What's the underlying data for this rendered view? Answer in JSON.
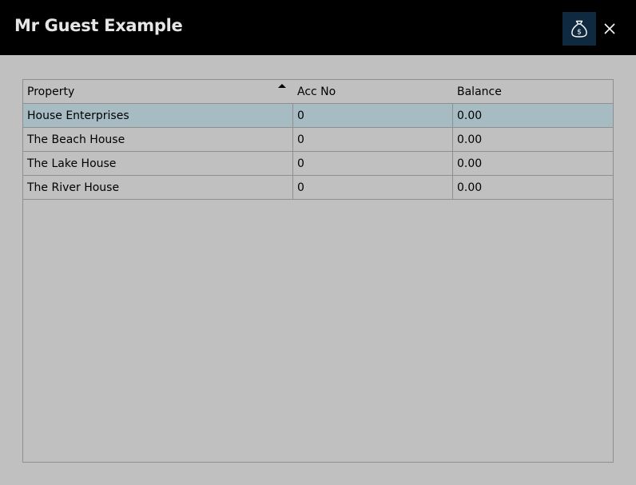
{
  "header": {
    "title": "Mr Guest Example",
    "money_icon": "money-bag-icon",
    "close_icon": "close-icon"
  },
  "table": {
    "columns": [
      "Property",
      "Acc No",
      "Balance"
    ],
    "sort_column": "Property",
    "sort_direction": "ascending",
    "rows": [
      {
        "property": "House Enterprises",
        "acc_no": "0",
        "balance": "0.00",
        "selected": true
      },
      {
        "property": "The Beach House",
        "acc_no": "0",
        "balance": "0.00",
        "selected": false
      },
      {
        "property": "The Lake House",
        "acc_no": "0",
        "balance": "0.00",
        "selected": false
      },
      {
        "property": "The River House",
        "acc_no": "0",
        "balance": "0.00",
        "selected": false
      }
    ]
  },
  "colors": {
    "header_bg": "#000000",
    "money_button_bg": "#0f2940",
    "page_bg": "#c0c0c0",
    "selected_row_bg": "#a6bcc2",
    "grid_line": "#8f8f8f"
  }
}
